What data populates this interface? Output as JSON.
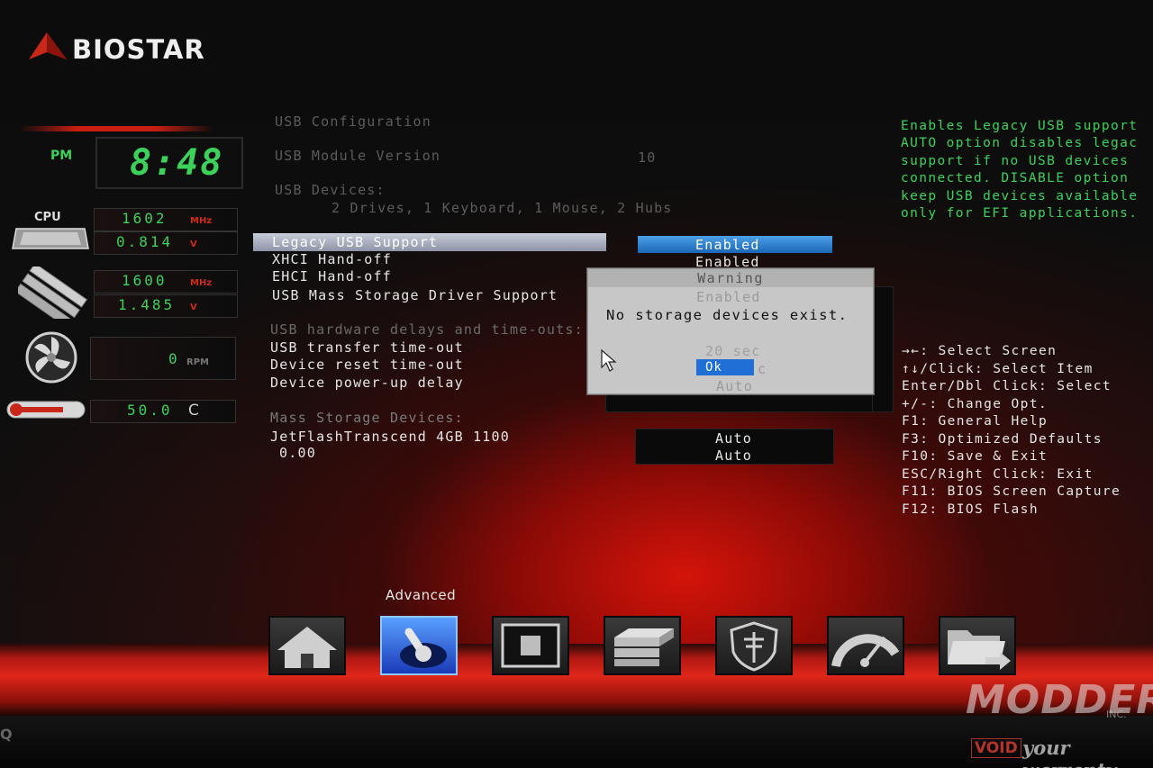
{
  "brand": {
    "logo_text": "BIOSTAR"
  },
  "clock": {
    "ampm": "PM",
    "time": "8:48"
  },
  "monitor": {
    "cpu_label": "CPU",
    "cpu_freq": "1602",
    "cpu_freq_unit": "MHz",
    "cpu_volt": "0.814",
    "cpu_volt_unit": "V",
    "mem_freq": "1600",
    "mem_freq_unit": "MHz",
    "mem_volt": "1.485",
    "mem_volt_unit": "V",
    "fan_rpm": "0",
    "fan_unit": "RPM",
    "temp": "50.0",
    "temp_unit": "C"
  },
  "content": {
    "usb_config_title": "USB Configuration",
    "usb_module_label": "USB Module Version",
    "usb_module_value": "10",
    "usb_devices_label": "USB Devices:",
    "usb_devices_value": "2 Drives, 1 Keyboard, 1 Mouse, 2 Hubs",
    "items": [
      {
        "label": "Legacy USB Support",
        "value": "Enabled"
      },
      {
        "label": "XHCI Hand-off",
        "value": "Enabled"
      },
      {
        "label": "EHCI Hand-off",
        "value": ""
      },
      {
        "label": "USB Mass Storage Driver Support",
        "value": "Enabled"
      }
    ],
    "delays_title": "USB hardware delays and time-outs:",
    "delays": [
      {
        "label": "USB transfer time-out",
        "value": "20 sec"
      },
      {
        "label": "Device reset time-out",
        "value": "c"
      },
      {
        "label": "Device power-up delay",
        "value": "Auto"
      }
    ],
    "mass_title": "Mass Storage Devices:",
    "mass_device_label": "JetFlashTranscend 4GB 1100",
    "mass_device_sub": "0.00",
    "mass_value_1": "Auto",
    "mass_value_2": "Auto"
  },
  "dialog": {
    "title": "Warning",
    "message": "No storage devices exist.",
    "ok_label": "Ok"
  },
  "help": {
    "description": [
      "Enables Legacy USB support",
      "AUTO option disables legac",
      "support if no USB devices",
      "connected. DISABLE option",
      "keep USB devices available",
      "only for EFI applications."
    ],
    "keys": [
      "→←: Select Screen",
      "↑↓/Click: Select Item",
      "Enter/Dbl Click: Select",
      "+/-: Change Opt.",
      "F1: General Help",
      "F3: Optimized Defaults",
      "F10: Save & Exit",
      "ESC/Right Click: Exit",
      "F11: BIOS Screen Capture",
      "F12: BIOS Flash"
    ]
  },
  "nav": {
    "active_label": "Advanced",
    "items": [
      "home-icon",
      "advanced-joystick-icon",
      "chipset-icon",
      "boot-icon",
      "security-icon",
      "oc-gauge-icon",
      "save-exit-icon"
    ]
  },
  "watermark": {
    "main": "MODDERS",
    "inc": "INC.",
    "void": "VOID",
    "tagline": "your warranty"
  },
  "bezel": {
    "brand_fragment": "Q"
  }
}
